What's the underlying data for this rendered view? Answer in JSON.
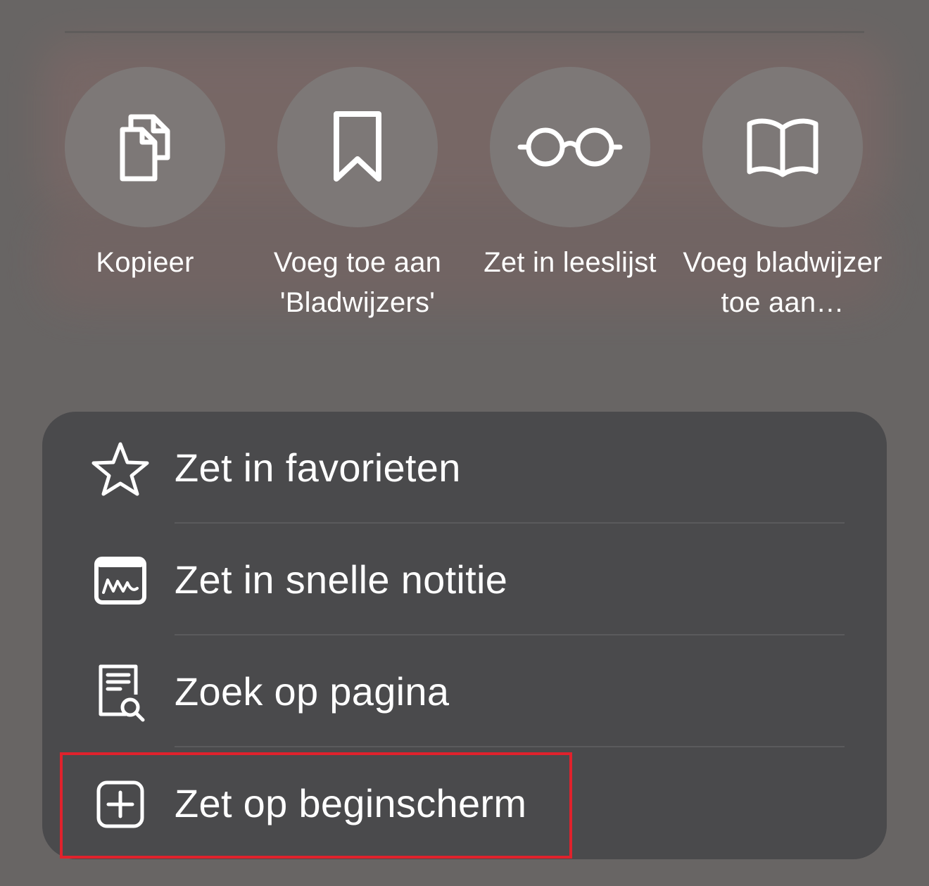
{
  "actions": [
    {
      "id": "copy",
      "icon": "copy-icon",
      "label": "Kopieer"
    },
    {
      "id": "bookmark",
      "icon": "bookmark-icon",
      "label": "Voeg toe aan 'Bladwijzers'"
    },
    {
      "id": "reading-list",
      "icon": "glasses-icon",
      "label": "Zet in leeslijst"
    },
    {
      "id": "add-bookmark-to",
      "icon": "book-icon",
      "label": "Voeg bladwijzer toe aan…"
    }
  ],
  "menu": [
    {
      "id": "favorites",
      "icon": "star-icon",
      "label": "Zet in favorieten"
    },
    {
      "id": "quick-note",
      "icon": "quick-note-icon",
      "label": "Zet in snelle notitie"
    },
    {
      "id": "find-on-page",
      "icon": "find-on-page-icon",
      "label": "Zoek op pagina"
    },
    {
      "id": "add-to-home",
      "icon": "plus-square-icon",
      "label": "Zet op beginscherm"
    }
  ],
  "colors": {
    "menu_bg": "#4a4a4c",
    "action_circle": "#7d7877",
    "highlight": "#e0222c"
  }
}
